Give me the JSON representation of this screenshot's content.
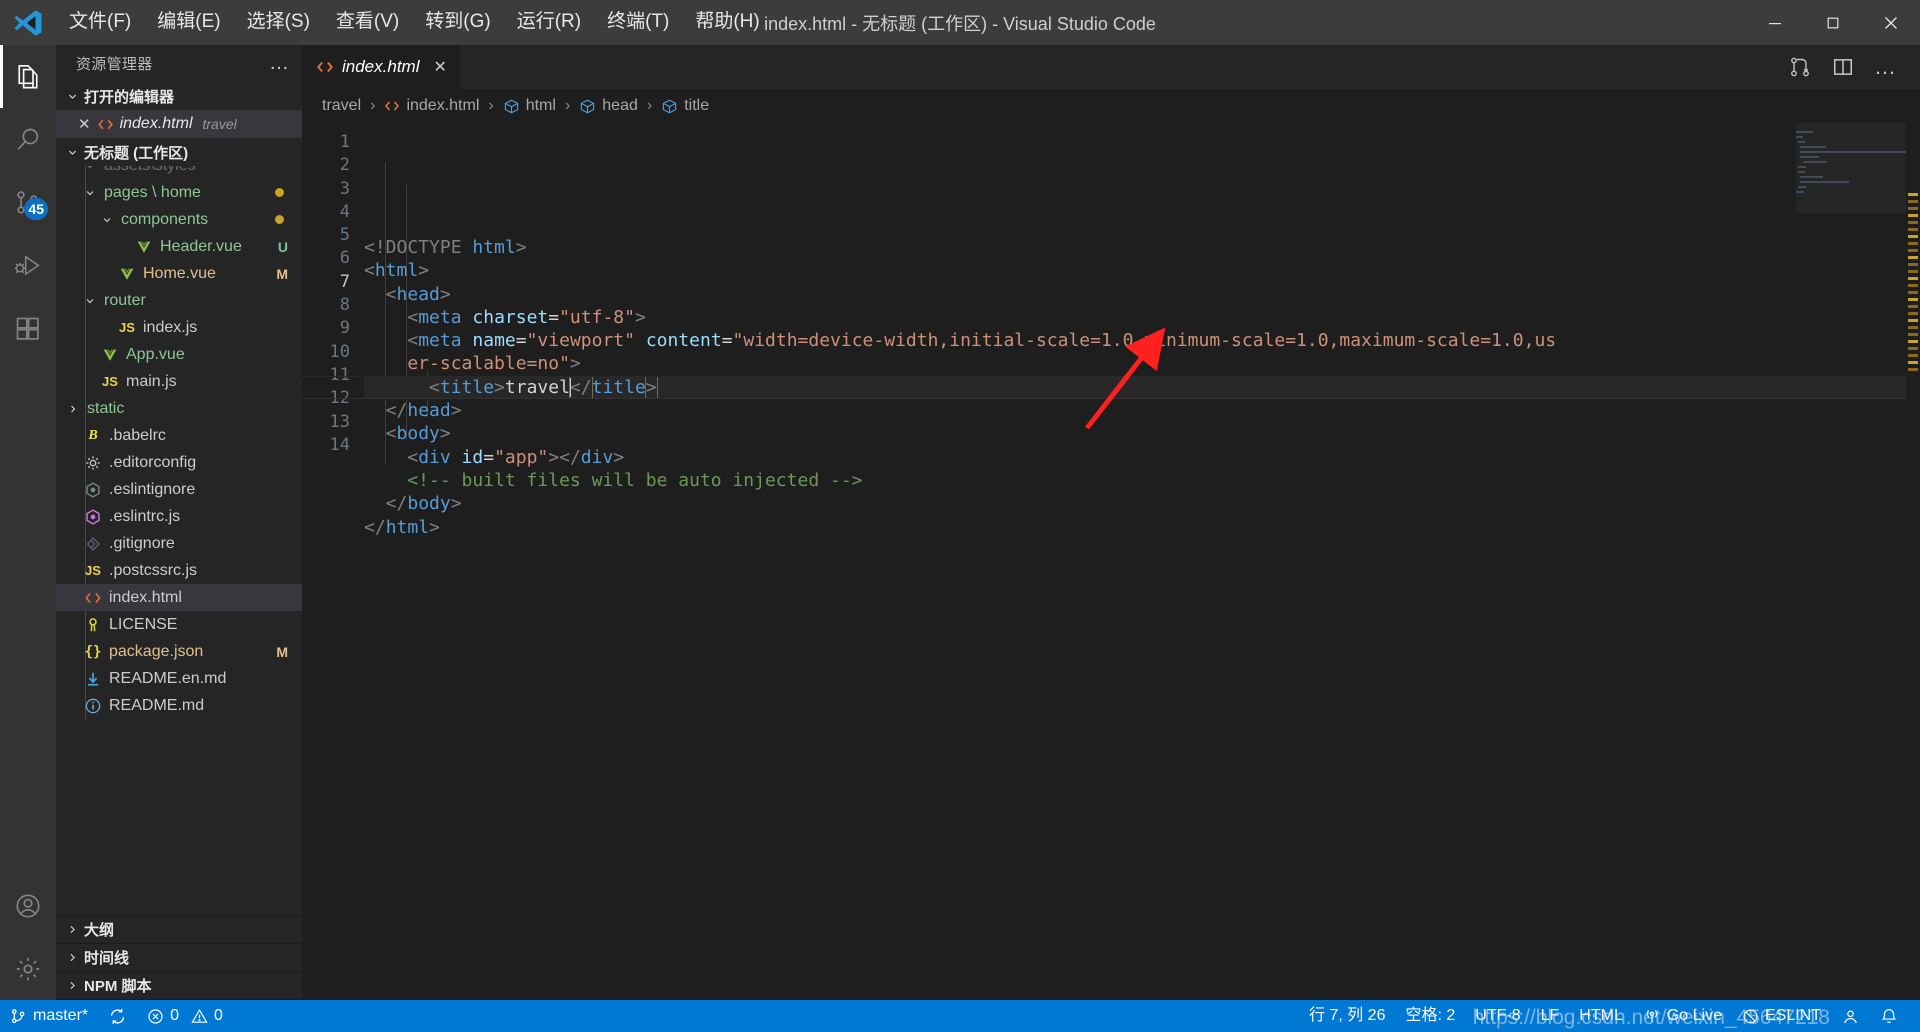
{
  "window": {
    "title": "index.html - 无标题 (工作区) - Visual Studio Code",
    "minimize_label": "最小化",
    "restore_label": "还原",
    "close_label": "关闭"
  },
  "menubar": {
    "items": [
      {
        "label": "文件(F)"
      },
      {
        "label": "编辑(E)"
      },
      {
        "label": "选择(S)"
      },
      {
        "label": "查看(V)"
      },
      {
        "label": "转到(G)"
      },
      {
        "label": "运行(R)"
      },
      {
        "label": "终端(T)"
      },
      {
        "label": "帮助(H)"
      }
    ]
  },
  "activitybar": {
    "items": [
      {
        "name": "explorer",
        "icon": "files-icon",
        "active": true,
        "badge": ""
      },
      {
        "name": "search",
        "icon": "search-icon",
        "active": false,
        "badge": ""
      },
      {
        "name": "source-control",
        "icon": "source-control-icon",
        "active": false,
        "badge": "45"
      },
      {
        "name": "run-and-debug",
        "icon": "run-debug-icon",
        "active": false,
        "badge": ""
      },
      {
        "name": "extensions",
        "icon": "extensions-icon",
        "active": false,
        "badge": ""
      }
    ],
    "bottom": [
      {
        "name": "accounts",
        "icon": "account-icon"
      },
      {
        "name": "manage",
        "icon": "gear-icon"
      }
    ]
  },
  "sidebar": {
    "title": "资源管理器",
    "more_actions": "…",
    "open_editors": {
      "header": "打开的编辑器",
      "items": [
        {
          "name": "index.html",
          "dir": "travel",
          "icon": "html-icon",
          "close": "✕"
        }
      ]
    },
    "workspace": {
      "header": "无标题 (工作区)",
      "tree": [
        {
          "label": "assets\\styles",
          "kind": "folder",
          "indent": 1,
          "twisty": "chevron-down",
          "clipped": true,
          "deco": "",
          "dot": ""
        },
        {
          "label": "pages \\ home",
          "kind": "folder",
          "indent": 1,
          "twisty": "chevron-down",
          "deco": "",
          "dot": "#c9a227"
        },
        {
          "label": "components",
          "kind": "folder",
          "indent": 2,
          "twisty": "chevron-down",
          "deco": "",
          "dot": "#c9a227"
        },
        {
          "label": "Header.vue",
          "kind": "vue",
          "indent": 3,
          "twisty": "",
          "deco": "U",
          "deco_color": "#73c991"
        },
        {
          "label": "Home.vue",
          "kind": "vue-modified",
          "indent": 2,
          "twisty": "",
          "deco": "M",
          "deco_color": "#e2c08d"
        },
        {
          "label": "router",
          "kind": "folder",
          "indent": 1,
          "twisty": "chevron-down",
          "deco": "",
          "dot": ""
        },
        {
          "label": "index.js",
          "kind": "js",
          "indent": 2,
          "twisty": "",
          "deco": "",
          "dot": ""
        },
        {
          "label": "App.vue",
          "kind": "vue",
          "indent": 1,
          "twisty": "",
          "deco": "",
          "dot": ""
        },
        {
          "label": "main.js",
          "kind": "js",
          "indent": 1,
          "twisty": "",
          "deco": "",
          "dot": ""
        },
        {
          "label": "static",
          "kind": "folder-collapsed",
          "indent": 0,
          "twisty": "chevron-right",
          "deco": "",
          "dot": ""
        },
        {
          "label": ".babelrc",
          "kind": "babel",
          "indent": 0,
          "twisty": "",
          "deco": "",
          "dot": ""
        },
        {
          "label": ".editorconfig",
          "kind": "editorconfig",
          "indent": 0,
          "twisty": "",
          "deco": "",
          "dot": ""
        },
        {
          "label": ".eslintignore",
          "kind": "eslint-ignore",
          "indent": 0,
          "twisty": "",
          "deco": "",
          "dot": ""
        },
        {
          "label": ".eslintrc.js",
          "kind": "eslint",
          "indent": 0,
          "twisty": "",
          "deco": "",
          "dot": ""
        },
        {
          "label": ".gitignore",
          "kind": "git",
          "indent": 0,
          "twisty": "",
          "deco": "",
          "dot": ""
        },
        {
          "label": ".postcssrc.js",
          "kind": "js",
          "indent": 0,
          "twisty": "",
          "deco": "",
          "dot": ""
        },
        {
          "label": "index.html",
          "kind": "html",
          "indent": 0,
          "twisty": "",
          "selected": true,
          "deco": "",
          "dot": ""
        },
        {
          "label": "LICENSE",
          "kind": "license",
          "indent": 0,
          "twisty": "",
          "deco": "",
          "dot": ""
        },
        {
          "label": "package.json",
          "kind": "json",
          "indent": 0,
          "twisty": "",
          "deco": "M",
          "deco_color": "#e2c08d"
        },
        {
          "label": "README.en.md",
          "kind": "markdown",
          "indent": 0,
          "twisty": "",
          "deco": "",
          "dot": ""
        },
        {
          "label": "README.md",
          "kind": "markdown-info",
          "indent": 0,
          "twisty": "",
          "deco": "",
          "dot": ""
        }
      ]
    },
    "bottom_sections": [
      {
        "label": "大纲"
      },
      {
        "label": "时间线"
      },
      {
        "label": "NPM 脚本"
      }
    ]
  },
  "editor": {
    "tabs": [
      {
        "label": "index.html",
        "icon": "html-icon",
        "close": "✕",
        "active": true
      }
    ],
    "tab_actions": [
      {
        "name": "split-changes-icon",
        "label": ""
      },
      {
        "name": "split-editor-icon",
        "label": ""
      },
      {
        "name": "more-actions-icon",
        "label": "…"
      }
    ],
    "breadcrumbs": [
      {
        "label": "travel",
        "icon": ""
      },
      {
        "label": "index.html",
        "icon": "html-icon"
      },
      {
        "label": "html",
        "icon": "symbol-field-icon"
      },
      {
        "label": "head",
        "icon": "symbol-field-icon"
      },
      {
        "label": "title",
        "icon": "symbol-field-icon"
      }
    ],
    "breadcrumb_separator": "›",
    "line_numbers": [
      "1",
      "2",
      "3",
      "4",
      "5",
      "6",
      "7",
      "8",
      "9",
      "10",
      "11",
      "12",
      "13",
      "14"
    ],
    "active_line": 7,
    "code_lines": [
      {
        "n": 1,
        "tokens": [
          {
            "t": "<!DOCTYPE ",
            "c": "brk"
          },
          {
            "t": "html",
            "c": "tag"
          },
          {
            "t": ">",
            "c": "brk"
          }
        ]
      },
      {
        "n": 2,
        "tokens": [
          {
            "t": "<",
            "c": "brk"
          },
          {
            "t": "html",
            "c": "tag"
          },
          {
            "t": ">",
            "c": "brk"
          }
        ]
      },
      {
        "n": 3,
        "tokens": [
          {
            "t": "  <",
            "c": "brk"
          },
          {
            "t": "head",
            "c": "tag"
          },
          {
            "t": ">",
            "c": "brk"
          }
        ]
      },
      {
        "n": 4,
        "tokens": [
          {
            "t": "    <",
            "c": "brk"
          },
          {
            "t": "meta",
            "c": "tag"
          },
          {
            "t": " ",
            "c": "txt"
          },
          {
            "t": "charset",
            "c": "attr"
          },
          {
            "t": "=",
            "c": "white"
          },
          {
            "t": "\"utf-8\"",
            "c": "str"
          },
          {
            "t": ">",
            "c": "brk"
          }
        ]
      },
      {
        "n": 5,
        "tokens": [
          {
            "t": "    <",
            "c": "brk"
          },
          {
            "t": "meta",
            "c": "tag"
          },
          {
            "t": " ",
            "c": "txt"
          },
          {
            "t": "name",
            "c": "attr"
          },
          {
            "t": "=",
            "c": "white"
          },
          {
            "t": "\"viewport\"",
            "c": "str"
          },
          {
            "t": " ",
            "c": "txt"
          },
          {
            "t": "content",
            "c": "attr"
          },
          {
            "t": "=",
            "c": "white"
          },
          {
            "t": "\"width=device-width,initial-scale=1.0,minimum-scale=1.0,maximum-scale=1.0,us",
            "c": "str"
          }
        ]
      },
      {
        "n": 6,
        "tokens": [
          {
            "t": "    er-scalable=no\"",
            "c": "str"
          },
          {
            "t": ">",
            "c": "brk"
          }
        ]
      },
      {
        "n": 7,
        "tokens": [
          {
            "t": "      <",
            "c": "brk"
          },
          {
            "t": "title",
            "c": "tag"
          },
          {
            "t": ">",
            "c": "brk"
          },
          {
            "t": "travel",
            "c": "white"
          },
          {
            "t": "</",
            "c": "brk"
          },
          {
            "t": "title",
            "c": "tag"
          },
          {
            "t": ">",
            "c": "brk"
          }
        ]
      },
      {
        "n": 8,
        "tokens": [
          {
            "t": "  </",
            "c": "brk"
          },
          {
            "t": "head",
            "c": "tag"
          },
          {
            "t": ">",
            "c": "brk"
          }
        ]
      },
      {
        "n": 9,
        "tokens": [
          {
            "t": "  <",
            "c": "brk"
          },
          {
            "t": "body",
            "c": "tag"
          },
          {
            "t": ">",
            "c": "brk"
          }
        ]
      },
      {
        "n": 10,
        "tokens": [
          {
            "t": "    <",
            "c": "brk"
          },
          {
            "t": "div",
            "c": "tag"
          },
          {
            "t": " ",
            "c": "txt"
          },
          {
            "t": "id",
            "c": "attr"
          },
          {
            "t": "=",
            "c": "white"
          },
          {
            "t": "\"app\"",
            "c": "str"
          },
          {
            "t": ">",
            "c": "brk"
          },
          {
            "t": "</",
            "c": "brk"
          },
          {
            "t": "div",
            "c": "tag"
          },
          {
            "t": ">",
            "c": "brk"
          }
        ]
      },
      {
        "n": 11,
        "tokens": [
          {
            "t": "    <!-- built files will be auto injected -->",
            "c": "cmt"
          }
        ]
      },
      {
        "n": 12,
        "tokens": [
          {
            "t": "  </",
            "c": "brk"
          },
          {
            "t": "body",
            "c": "tag"
          },
          {
            "t": ">",
            "c": "brk"
          }
        ]
      },
      {
        "n": 13,
        "tokens": [
          {
            "t": "</",
            "c": "brk"
          },
          {
            "t": "html",
            "c": "tag"
          },
          {
            "t": ">",
            "c": "brk"
          }
        ]
      },
      {
        "n": 14,
        "tokens": []
      }
    ],
    "annotation": {
      "type": "red-arrow",
      "color": "#ff2020"
    }
  },
  "statusbar": {
    "left": [
      {
        "name": "remote-branch",
        "icon": "source-control-icon",
        "label": "master*"
      },
      {
        "name": "sync",
        "icon": "sync-icon",
        "label": ""
      },
      {
        "name": "problems",
        "icon": "error-warning-icon",
        "label": "0  0",
        "errors": "0",
        "warnings": "0"
      }
    ],
    "right": [
      {
        "name": "cursor-position",
        "label": "行 7, 列 26"
      },
      {
        "name": "indentation",
        "label": "空格: 2"
      },
      {
        "name": "encoding",
        "label": "UTF-8"
      },
      {
        "name": "eol",
        "label": "LF"
      },
      {
        "name": "language-mode",
        "label": "HTML"
      },
      {
        "name": "go-live",
        "label": "Go Live",
        "icon": "broadcast-icon"
      },
      {
        "name": "eslint",
        "label": "ESLINT",
        "icon": "eslint-blocked-icon"
      },
      {
        "name": "accounts",
        "label": "",
        "icon": "account-icon"
      },
      {
        "name": "notifications",
        "label": "",
        "icon": "bell-icon"
      }
    ],
    "watermark": "https://blog.csdn.net/weixin_45647218",
    "accent_color": "#0078d4"
  },
  "colors": {
    "titlebar_bg": "#3c3c3c",
    "activitybar_bg": "#333333",
    "sidebar_bg": "#252526",
    "editor_bg": "#1e1e1e",
    "statusbar_bg": "#0078d4",
    "selection_bg": "#37373d",
    "badge_bg": "#0e70c0",
    "tag_color": "#569cd6",
    "attr_color": "#9cdcfe",
    "string_color": "#ce9178",
    "comment_color": "#6a9955",
    "arrow_color": "#ff2020"
  }
}
